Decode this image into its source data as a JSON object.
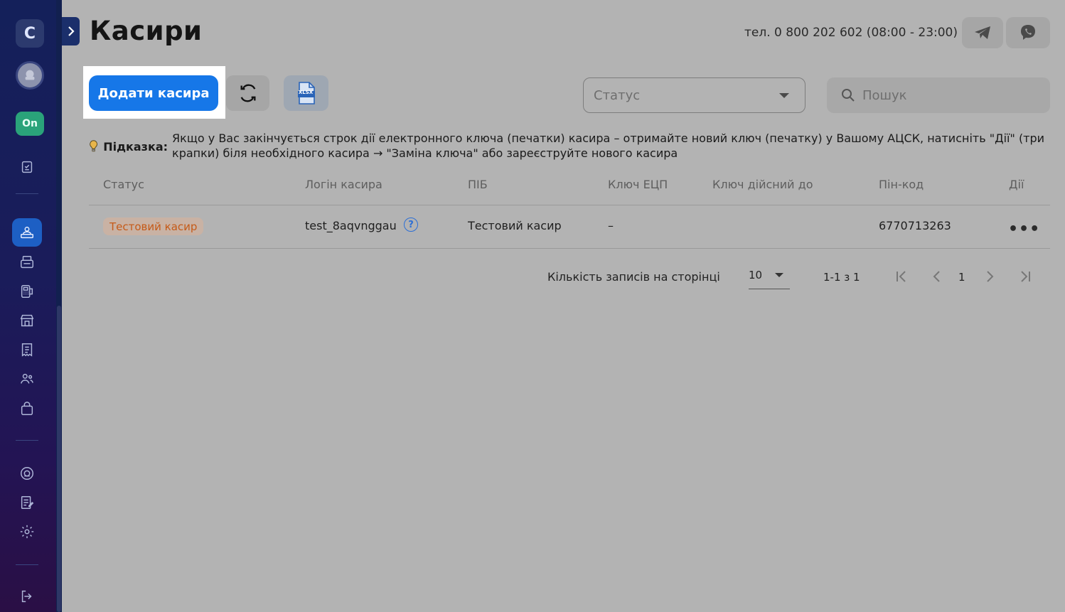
{
  "sidebar": {
    "logo_letter": "C",
    "status_badge": "On",
    "items": [
      {
        "name": "reports",
        "icon": "clipboard-check-icon"
      },
      {
        "name": "cashiers",
        "icon": "cashiers-icon",
        "active": true
      },
      {
        "name": "cash-registers",
        "icon": "printer-icon"
      },
      {
        "name": "pos-terminals",
        "icon": "pos-terminal-icon"
      },
      {
        "name": "stores",
        "icon": "store-icon"
      },
      {
        "name": "receipts",
        "icon": "receipt-icon"
      },
      {
        "name": "users",
        "icon": "users-icon"
      },
      {
        "name": "products",
        "icon": "bag-icon"
      },
      {
        "name": "support",
        "icon": "support-icon"
      },
      {
        "name": "documents",
        "icon": "document-edit-icon"
      },
      {
        "name": "settings",
        "icon": "gear-icon"
      },
      {
        "name": "logout",
        "icon": "logout-icon"
      }
    ]
  },
  "header": {
    "title": "Касири",
    "phone": "тел. 0 800 202 602 (08:00 - 23:00)"
  },
  "toolbar": {
    "add_label": "Додати касира",
    "xlsx_label": "XLSX",
    "status_placeholder": "Статус",
    "search_placeholder": "Пошук"
  },
  "hint": {
    "label": "Підказка:",
    "text": "Якщо у Вас закінчується строк дії електронного ключа (печатки) касира – отримайте новий ключ (печатку) у Вашому АЦСК, натисніть \"Дії\" (три крапки) біля необхідного касира → \"Заміна ключа\" або зареєструйте нового касира"
  },
  "table": {
    "columns": [
      "Статус",
      "Логін касира",
      "ПІБ",
      "Ключ ЕЦП",
      "Ключ дійсний до",
      "Пін-код",
      "Дії"
    ],
    "rows": [
      {
        "status": "Тестовий касир",
        "login": "test_8aqvnggau",
        "name": "Тестовий касир",
        "key": "–",
        "valid_until": "",
        "pin": "6770713263",
        "actions": "•••"
      }
    ]
  },
  "pagination": {
    "per_page_label": "Кількість записів на сторінці",
    "per_page": "10",
    "range": "1-1 з 1",
    "current_page": "1"
  },
  "colors": {
    "primary": "#1677e8",
    "badge_text": "#c55a18",
    "sidebar_active": "#1d5fc4",
    "on_badge": "#2aa37a"
  }
}
